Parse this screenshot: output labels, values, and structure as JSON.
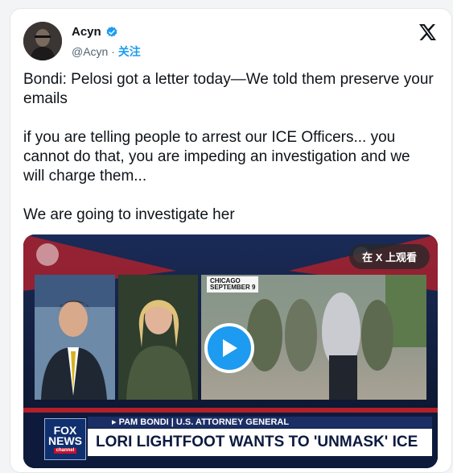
{
  "author": {
    "display_name": "Acyn",
    "handle": "@Acyn",
    "separator": "·",
    "follow_label": "关注"
  },
  "tweet": {
    "paragraphs": [
      "Bondi: Pelosi got a letter today—We told them preserve your emails",
      "if you are telling people to arrest our ICE Officers... you cannot do that, you are impeding an investigation and we will charge them...",
      "We are going to investigate her"
    ]
  },
  "video": {
    "watch_on_x_label": "在 X 上观看",
    "location_city": "CHICAGO",
    "location_date": "SEPTEMBER 9",
    "network_logo_line1": "FOX",
    "network_logo_line2": "NEWS",
    "network_logo_line3": "channel",
    "name_strap": "▸ PAM BONDI | U.S. ATTORNEY GENERAL",
    "headline": "LORI LIGHTFOOT WANTS TO 'UNMASK' ICE"
  },
  "colors": {
    "accent": "#1d9bf0",
    "text": "#0f1419",
    "muted": "#536471"
  },
  "icons": [
    "verified-badge-icon",
    "x-logo-icon",
    "play-icon"
  ]
}
